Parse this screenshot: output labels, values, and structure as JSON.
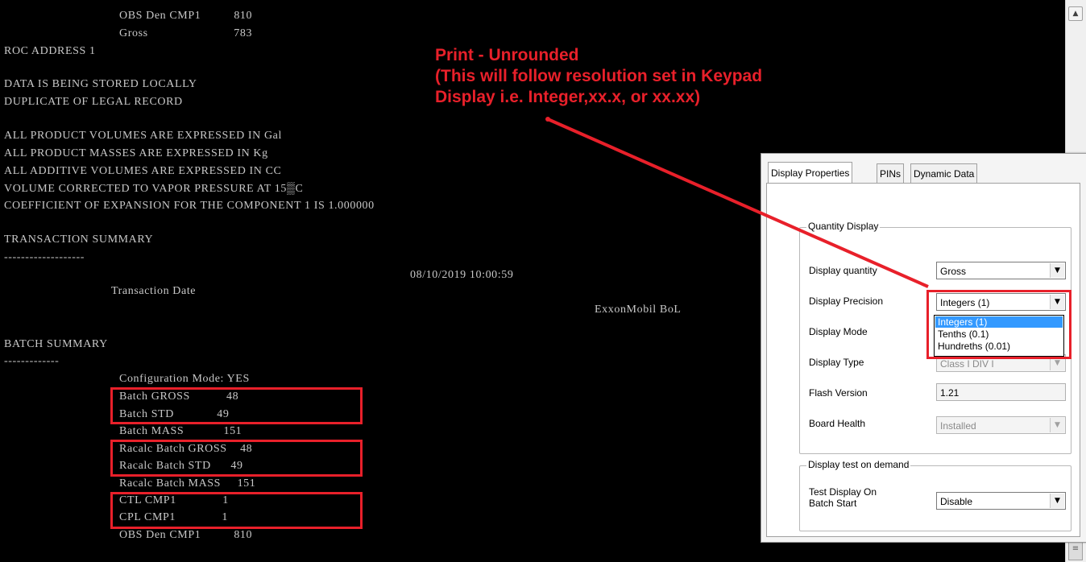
{
  "terminal": {
    "lines": [
      "OBS Den CMP1          810",
      "Gross                          783",
      "ROC ADDRESS 1",
      "DATA IS BEING STORED LOCALLY",
      "DUPLICATE OF LEGAL RECORD",
      "ALL PRODUCT VOLUMES ARE EXPRESSED IN Gal",
      "ALL PRODUCT MASSES ARE EXPRESSED IN Kg",
      "ALL ADDITIVE VOLUMES ARE EXPRESSED IN CC",
      "VOLUME CORRECTED TO VAPOR PRESSURE AT 15▒C",
      "COEFFICIENT OF EXPANSION FOR THE COMPONENT 1 IS 1.000000",
      "TRANSACTION SUMMARY",
      "-------------------",
      "08/10/2019 10:00:59",
      "Transaction Date",
      "ExxonMobil BoL",
      "BATCH SUMMARY",
      "-------------",
      "Configuration Mode: YES",
      "Batch GROSS           48",
      "Batch STD             49",
      "Batch MASS            151",
      "Racalc Batch GROSS    48",
      "Racalc Batch STD      49",
      "Racalc Batch MASS     151",
      "CTL CMP1              1",
      "CPL CMP1              1",
      "OBS Den CMP1          810"
    ]
  },
  "callout": {
    "line1": "Print - Unrounded",
    "line2": "(This will follow resolution set in Keypad",
    "line3": "Display i.e. Integer,xx.x, or xx.xx)"
  },
  "dialog": {
    "tabs": [
      "Display Properties",
      "PINs",
      "Dynamic Data"
    ],
    "quantity_group": {
      "title": "Quantity Display",
      "display_quantity_label": "Display quantity",
      "display_quantity_value": "Gross",
      "display_precision_label": "Display Precision",
      "display_precision_value": "Integers (1)",
      "display_mode_label": "Display Mode",
      "display_type_label": "Display Type",
      "display_type_value": "Class I DIV I",
      "flash_version_label": "Flash Version",
      "flash_version_value": "1.21",
      "board_health_label": "Board Health",
      "board_health_value": "Installed"
    },
    "precision_options": [
      "Integers (1)",
      "Tenths (0.1)",
      "Hundreths (0.01)"
    ],
    "test_group": {
      "title": "Display test on demand",
      "label_line1": "Test Display On",
      "label_line2": "Batch Start",
      "value": "Disable"
    }
  },
  "colors": {
    "highlight": "#e8202a",
    "terminal_bg": "#000000",
    "selection": "#3399ff"
  },
  "icons": {
    "scroll_up": "triangle-up",
    "dropdown": "triangle-down"
  }
}
